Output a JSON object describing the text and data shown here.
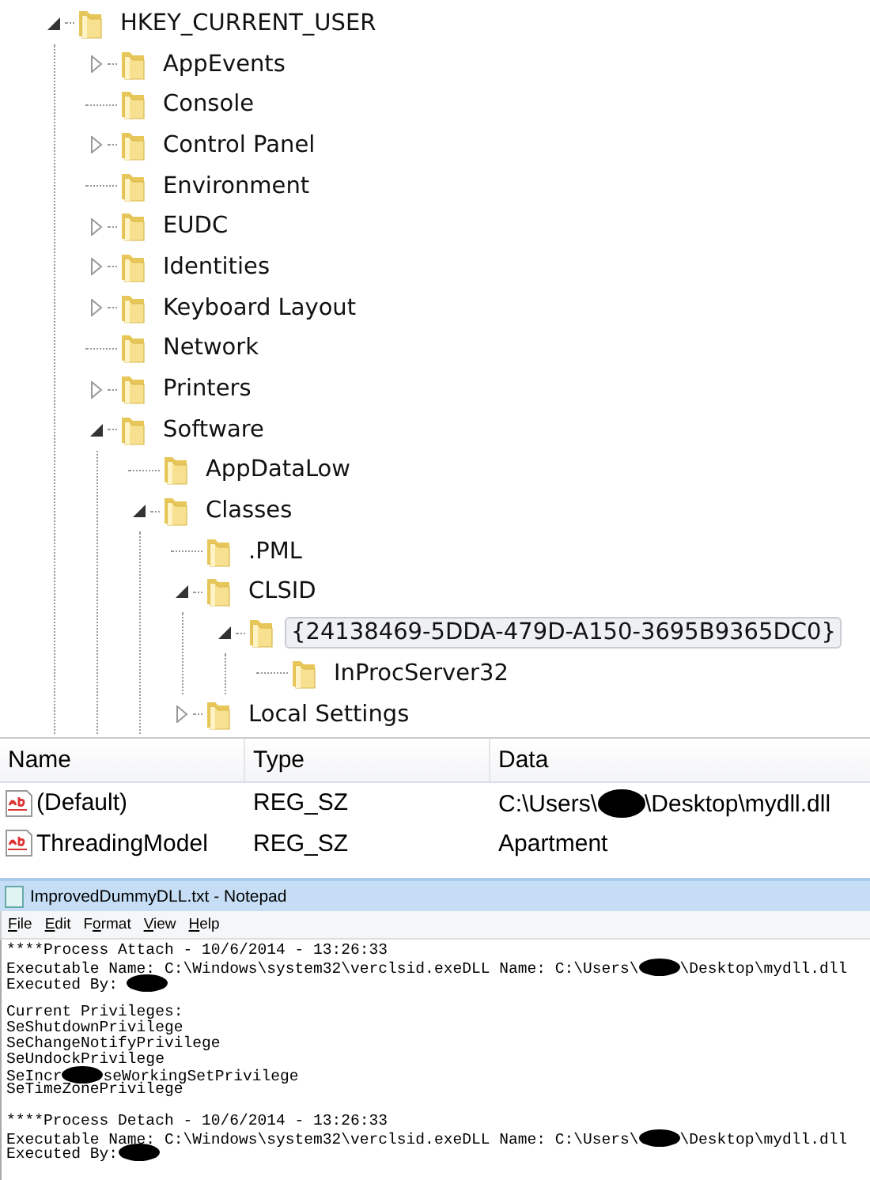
{
  "tree": {
    "label": "HKEY_CURRENT_USER",
    "kind": "branch",
    "expanded": true,
    "selected": false,
    "children": [
      {
        "label": "AppEvents",
        "kind": "branch",
        "expanded": false,
        "selected": false
      },
      {
        "label": "Console",
        "kind": "leaf",
        "selected": false
      },
      {
        "label": "Control Panel",
        "kind": "branch",
        "expanded": false,
        "selected": false
      },
      {
        "label": "Environment",
        "kind": "leaf",
        "selected": false
      },
      {
        "label": "EUDC",
        "kind": "branch",
        "expanded": false,
        "selected": false
      },
      {
        "label": "Identities",
        "kind": "branch",
        "expanded": false,
        "selected": false
      },
      {
        "label": "Keyboard Layout",
        "kind": "branch",
        "expanded": false,
        "selected": false
      },
      {
        "label": "Network",
        "kind": "leaf",
        "selected": false
      },
      {
        "label": "Printers",
        "kind": "branch",
        "expanded": false,
        "selected": false
      },
      {
        "label": "Software",
        "kind": "branch",
        "expanded": true,
        "selected": false,
        "children": [
          {
            "label": "AppDataLow",
            "kind": "leaf",
            "selected": false
          },
          {
            "label": "Classes",
            "kind": "branch",
            "expanded": true,
            "selected": false,
            "children": [
              {
                "label": ".PML",
                "kind": "leaf",
                "selected": false
              },
              {
                "label": "CLSID",
                "kind": "branch",
                "expanded": true,
                "selected": false,
                "children": [
                  {
                    "label": "{24138469-5DDA-479D-A150-3695B9365DC0}",
                    "kind": "branch",
                    "expanded": true,
                    "selected": true,
                    "children": [
                      {
                        "label": "InProcServer32",
                        "kind": "leaf",
                        "selected": false
                      }
                    ]
                  }
                ]
              },
              {
                "label": "Local Settings",
                "kind": "branch",
                "expanded": false,
                "selected": false
              }
            ]
          }
        ]
      }
    ]
  },
  "values": {
    "columns": [
      "Name",
      "Type",
      "Data"
    ],
    "rows": [
      {
        "name": "(Default)",
        "type": "REG_SZ",
        "data": [
          {
            "kind": "text",
            "text": "C:\\Users\\"
          },
          {
            "kind": "redaction"
          },
          {
            "kind": "text",
            "text": "\\Desktop\\mydll.dll"
          }
        ]
      },
      {
        "name": "ThreadingModel",
        "type": "REG_SZ",
        "data": [
          {
            "kind": "text",
            "text": "Apartment"
          }
        ]
      }
    ]
  },
  "notepad": {
    "title": "ImprovedDummyDLL.txt - Notepad",
    "menu": [
      {
        "key": "F",
        "rest": "ile"
      },
      {
        "key": "E",
        "rest": "dit"
      },
      {
        "pre": "F",
        "key": "o",
        "rest": "rmat"
      },
      {
        "key": "V",
        "rest": "iew"
      },
      {
        "key": "H",
        "rest": "elp"
      }
    ],
    "lines": [
      {
        "kind": "text",
        "segments": [
          {
            "kind": "text",
            "text": "****Process Attach - 10/6/2014 - 13:26:33"
          }
        ]
      },
      {
        "kind": "text",
        "segments": [
          {
            "kind": "text",
            "text": "Executable Name: C:\\Windows\\system32\\verclsid.exeDLL Name: C:\\Users\\"
          },
          {
            "kind": "redaction"
          },
          {
            "kind": "text",
            "text": "\\Desktop\\mydll.dll"
          }
        ]
      },
      {
        "kind": "text",
        "segments": [
          {
            "kind": "text",
            "text": "Executed By: "
          },
          {
            "kind": "redaction"
          }
        ]
      },
      {
        "kind": "blank"
      },
      {
        "kind": "text",
        "segments": [
          {
            "kind": "text",
            "text": "Current Privileges:"
          }
        ]
      },
      {
        "kind": "text",
        "segments": [
          {
            "kind": "text",
            "text": "SeShutdownPrivilege"
          }
        ]
      },
      {
        "kind": "text",
        "segments": [
          {
            "kind": "text",
            "text": "SeChangeNotifyPrivilege"
          }
        ]
      },
      {
        "kind": "text",
        "segments": [
          {
            "kind": "text",
            "text": "SeUndockPrivilege"
          }
        ]
      },
      {
        "kind": "text",
        "segments": [
          {
            "kind": "text",
            "text": "SeIncr"
          },
          {
            "kind": "redaction"
          },
          {
            "kind": "text",
            "text": "seWorkingSetPrivilege"
          }
        ]
      },
      {
        "kind": "text",
        "segments": [
          {
            "kind": "text",
            "text": "SeTimeZonePrivilege"
          }
        ]
      },
      {
        "kind": "blank"
      },
      {
        "kind": "text",
        "segments": [
          {
            "kind": "text",
            "text": "****Process Detach - 10/6/2014 - 13:26:33"
          }
        ]
      },
      {
        "kind": "text",
        "segments": [
          {
            "kind": "text",
            "text": "Executable Name: C:\\Windows\\system32\\verclsid.exeDLL Name: C:\\Users\\"
          },
          {
            "kind": "redaction"
          },
          {
            "kind": "text",
            "text": "\\Desktop\\mydll.dll"
          }
        ]
      },
      {
        "kind": "text",
        "segments": [
          {
            "kind": "text",
            "text": "Executed By:"
          },
          {
            "kind": "redaction"
          }
        ]
      }
    ]
  }
}
